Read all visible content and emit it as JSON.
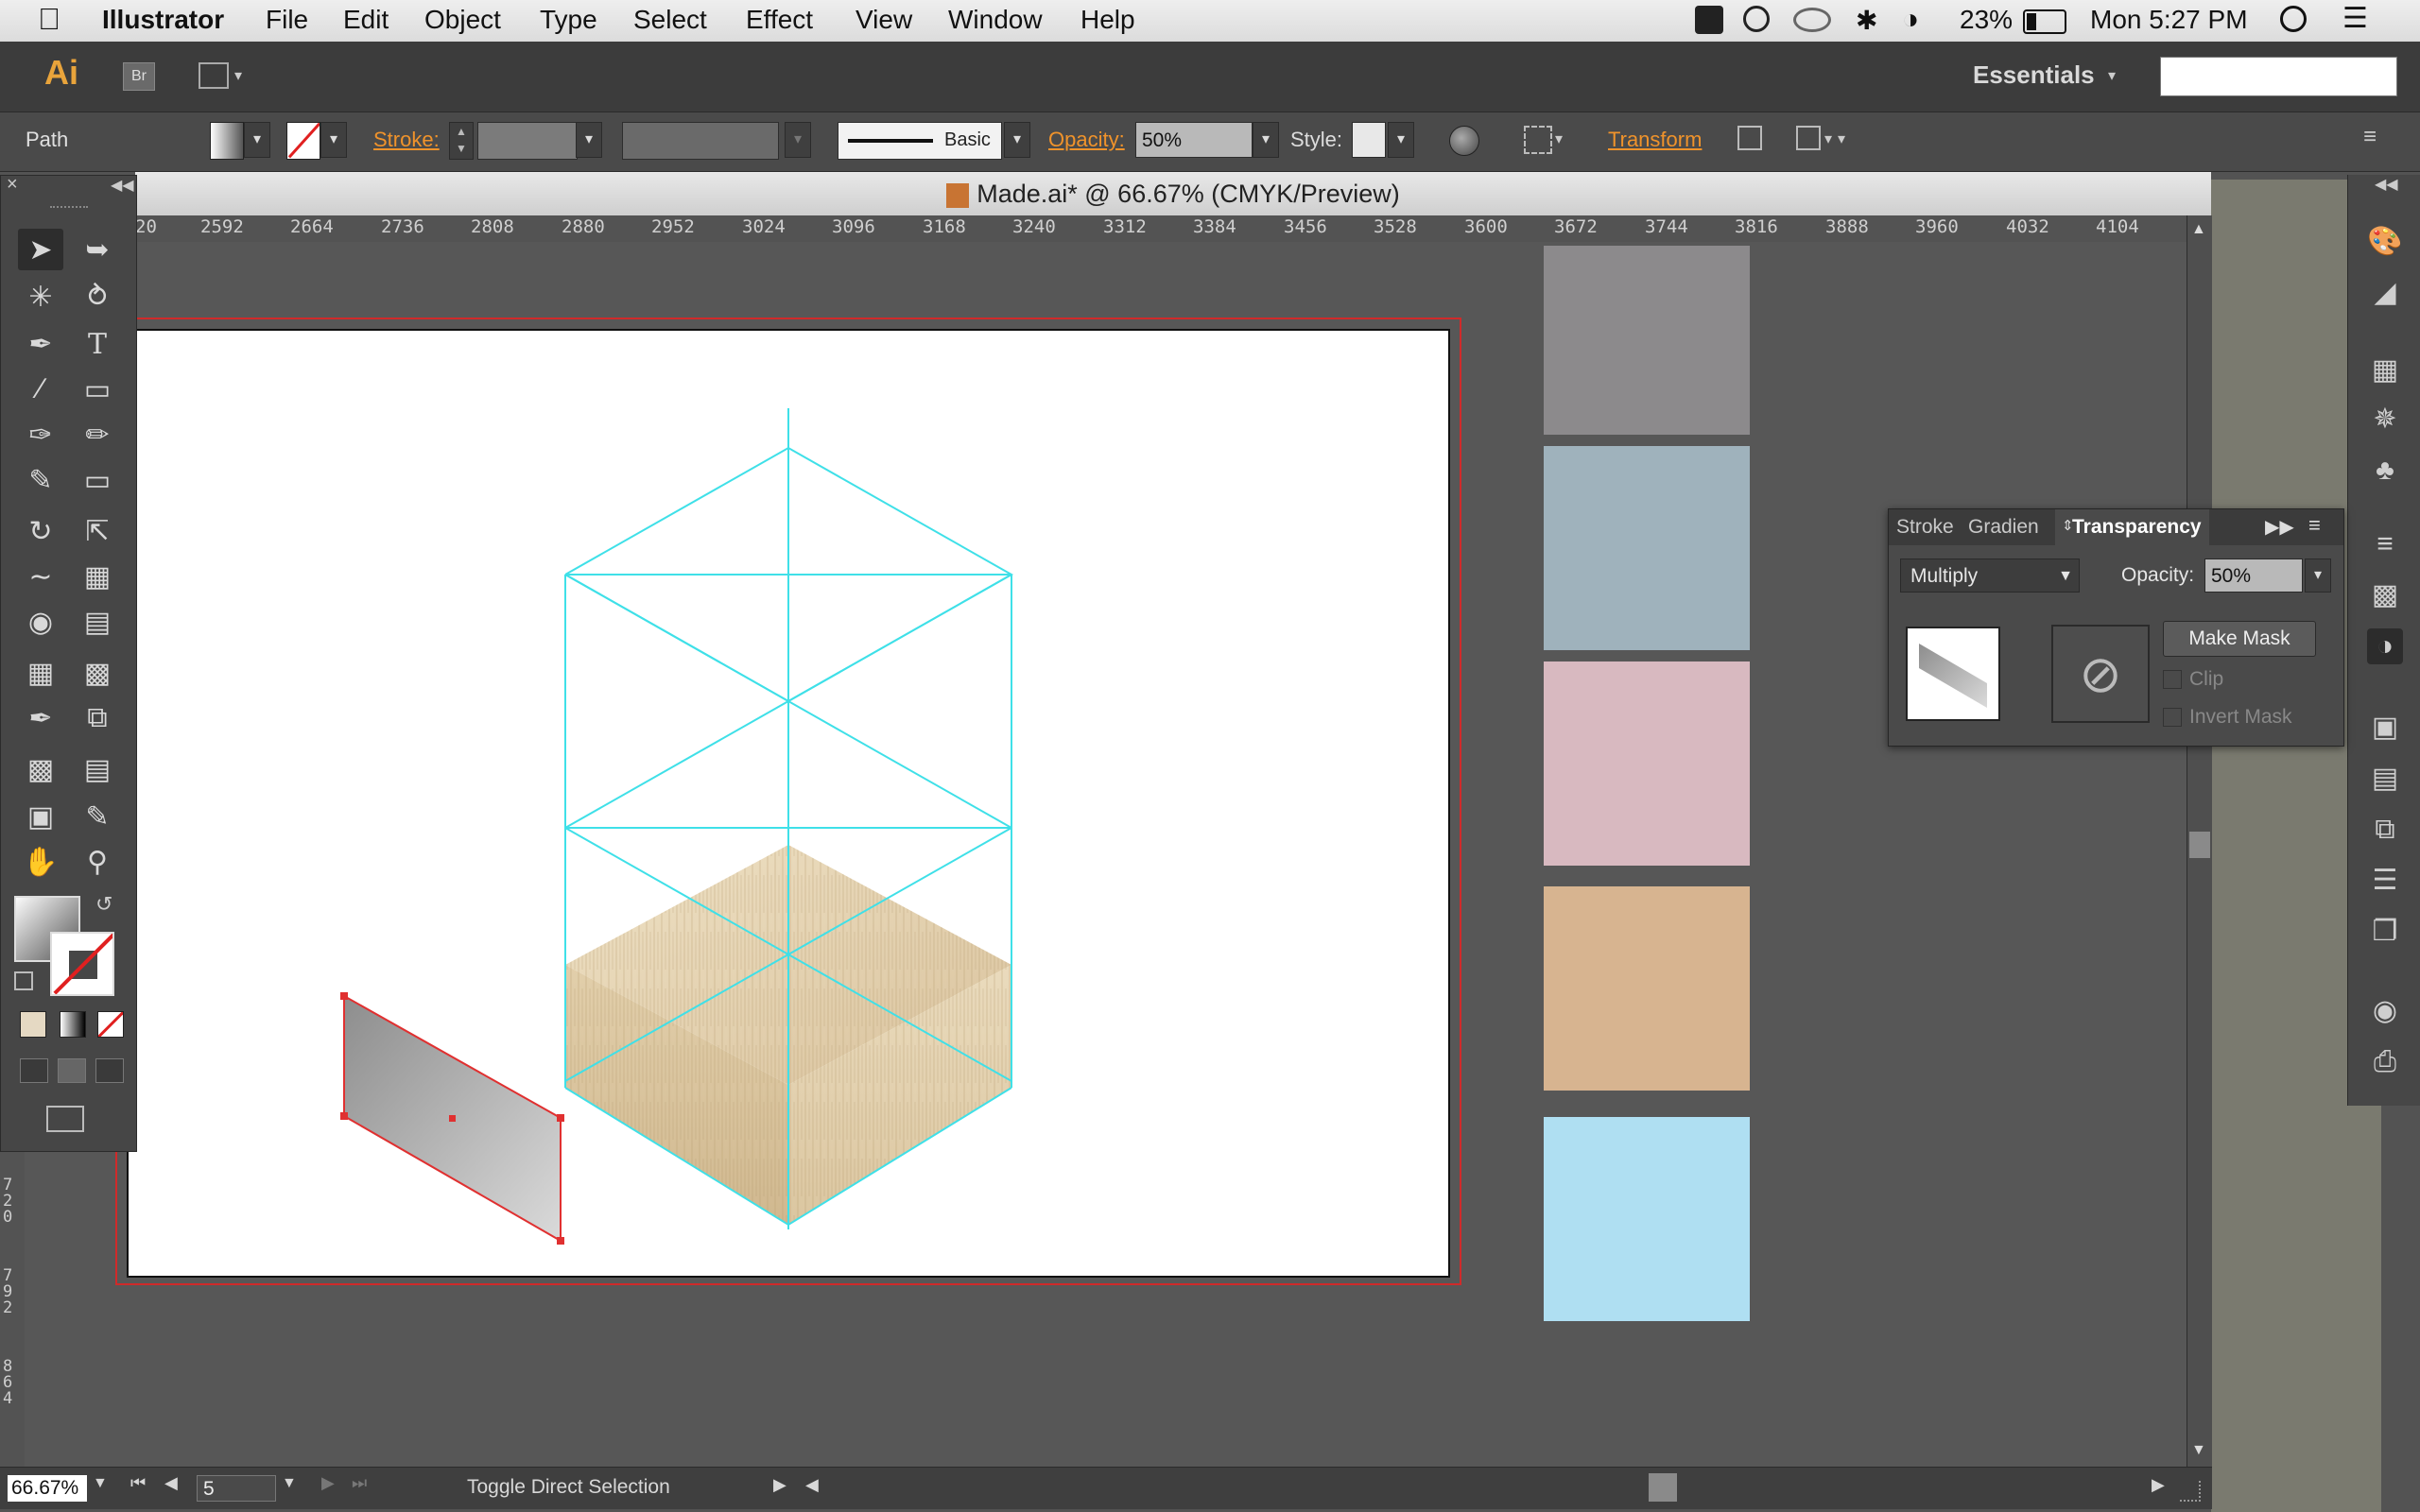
{
  "menubar": {
    "app_name": "Illustrator",
    "items": [
      "File",
      "Edit",
      "Object",
      "Type",
      "Select",
      "Effect",
      "View",
      "Window",
      "Help"
    ],
    "battery": "23%",
    "clock": "Mon 5:27 PM"
  },
  "appbar": {
    "ai_logo": "Ai",
    "br_logo": "Br",
    "workspace": "Essentials"
  },
  "control": {
    "selection_type": "Path",
    "stroke_label": "Stroke:",
    "brush_name": "Basic",
    "opacity_label": "Opacity:",
    "opacity_value": "50%",
    "style_label": "Style:",
    "transform_label": "Transform"
  },
  "document": {
    "title": "Made.ai* @ 66.67% (CMYK/Preview)"
  },
  "ruler": {
    "top_ticks": [
      "20",
      "2592",
      "2664",
      "2736",
      "2808",
      "2880",
      "2952",
      "3024",
      "3096",
      "3168",
      "3240",
      "3312",
      "3384",
      "3456",
      "3528",
      "3600",
      "3672",
      "3744",
      "3816",
      "3888",
      "3960",
      "4032",
      "4104"
    ],
    "left_ticks": [
      "720",
      "792",
      "864"
    ]
  },
  "swatches": {
    "colors": [
      "#8c8a8c",
      "#9fb2bc",
      "#d8b9c0",
      "#d7b490",
      "#afdff2"
    ]
  },
  "transparency_panel": {
    "tabs": [
      "Stroke",
      "Gradien",
      "Transparency"
    ],
    "blend_mode": "Multiply",
    "opacity_label": "Opacity:",
    "opacity_value": "50%",
    "make_mask": "Make Mask",
    "clip_label": "Clip",
    "invert_mask_label": "Invert Mask"
  },
  "status": {
    "zoom": "66.67%",
    "artboard": "5",
    "message": "Toggle Direct Selection"
  }
}
